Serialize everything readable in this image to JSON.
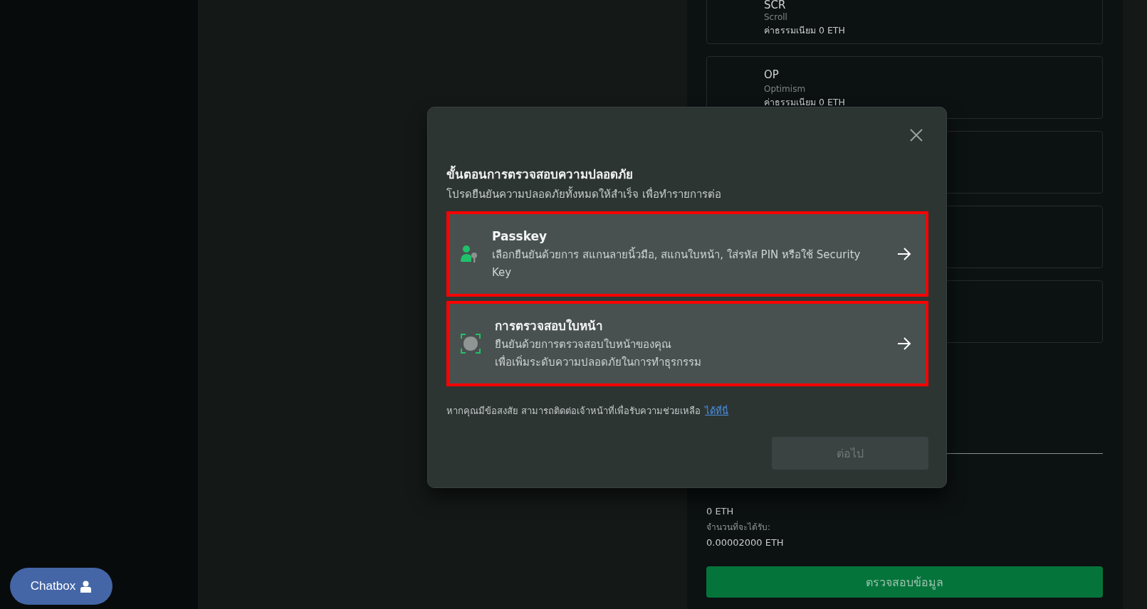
{
  "right_panel": {
    "networks": [
      {
        "symbol": "SCR",
        "name": "Scroll",
        "fee": "ค่าธรรมเนียม 0 ETH"
      },
      {
        "symbol": "OP",
        "name": "Optimism",
        "fee": "ค่าธรรมเนียม 0 ETH"
      }
    ],
    "summary": [
      {
        "kind": "value",
        "text": "0 ETH"
      },
      {
        "kind": "label",
        "text": "จำนวนที่จะได้รับ:"
      },
      {
        "kind": "value",
        "text": "0.00002000 ETH"
      }
    ],
    "submit_button": "ตรวจสอบข้อมูล"
  },
  "modal": {
    "title": "ขั้นตอนการตรวจสอบความปลอดภัย",
    "subtitle": "โปรดยืนยันความปลอดภัยทั้งหมดให้สำเร็จ เพื่อทำรายการต่อ",
    "options": [
      {
        "kind": "passkey",
        "title": "Passkey",
        "description": "เลือกยืนยันด้วยการ สแกนลายนิ้วมือ, สแกนใบหน้า, ใส่รหัส PIN หรือใช้ Security Key",
        "highlighted": true
      },
      {
        "kind": "face",
        "title": "การตรวจสอบใบหน้า",
        "description": "ยืนยันด้วยการตรวจสอบใบหน้าของคุณ\nเพื่อเพิ่มระดับความปลอดภัยในการทำธุรกรรม",
        "highlighted": true
      }
    ],
    "help_text": "หากคุณมีข้อสงสัย สามารถติดต่อเจ้าหน้าที่เพื่อรับความช่วยเหลือ",
    "help_link": "ได้ที่นี่",
    "next_button": {
      "label": "ต่อไป",
      "disabled": true
    }
  },
  "chat_button": "Chatbox"
}
